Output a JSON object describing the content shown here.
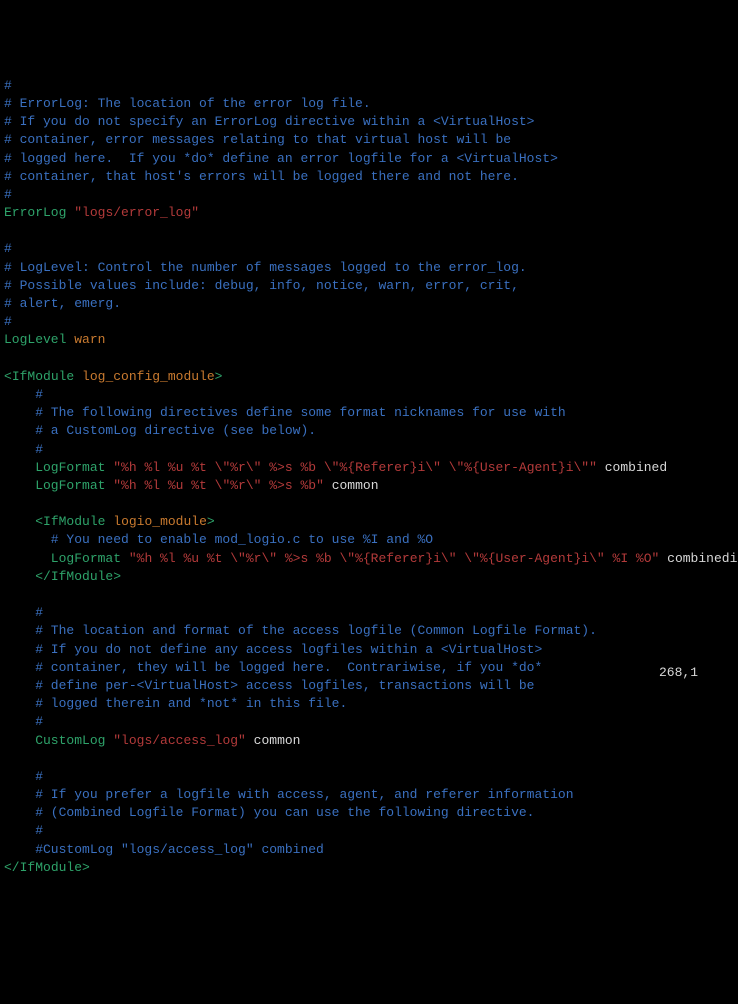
{
  "lines": {
    "c1": "#",
    "c2": "# ErrorLog: The location of the error log file.",
    "c3": "# If you do not specify an ErrorLog directive within a <VirtualHost>",
    "c4": "# container, error messages relating to that virtual host will be",
    "c5": "# logged here.  If you *do* define an error logfile for a <VirtualHost>",
    "c6": "# container, that host's errors will be logged there and not here.",
    "c7": "#",
    "errorlog_key": "ErrorLog",
    "errorlog_val": "\"logs/error_log\"",
    "blank1": "",
    "c8": "#",
    "c9": "# LogLevel: Control the number of messages logged to the error_log.",
    "c10": "# Possible values include: debug, info, notice, warn, error, crit,",
    "c11": "# alert, emerg.",
    "c12": "#",
    "loglevel_key": "LogLevel",
    "loglevel_val": "warn",
    "blank2": "",
    "ifmod_open_lt": "<",
    "ifmod_open_tag": "IfModule",
    "ifmod_open_arg": "log_config_module",
    "ifmod_open_gt": ">",
    "c13": "    #",
    "c14": "    # The following directives define some format nicknames for use with",
    "c15": "    # a CustomLog directive (see below).",
    "c16": "    #",
    "lf1_key": "    LogFormat",
    "lf1_val": "\"%h %l %u %t \\\"%r\\\" %>s %b \\\"%{Referer}i\\\" \\\"%{User-Agent}i\\\"\"",
    "lf1_name": "combined",
    "lf2_key": "    LogFormat",
    "lf2_val": "\"%h %l %u %t \\\"%r\\\" %>s %b\"",
    "lf2_name": "common",
    "blank3": "",
    "ifmod2_indent": "    ",
    "ifmod2_open_lt": "<",
    "ifmod2_open_tag": "IfModule",
    "ifmod2_open_arg": "logio_module",
    "ifmod2_open_gt": ">",
    "c17": "      # You need to enable mod_logio.c to use %I and %O",
    "lf3_key": "      LogFormat",
    "lf3_val": "\"%h %l %u %t \\\"%r\\\" %>s %b \\\"%{Referer}i\\\" \\\"%{User-Agent}i\\\" %I %O\"",
    "lf3_name": "combinedio",
    "ifmod2_close_indent": "    ",
    "ifmod2_close_lt": "</",
    "ifmod2_close_tag": "IfModule",
    "ifmod2_close_gt": ">",
    "blank4": "",
    "c18": "    #",
    "c19": "    # The location and format of the access logfile (Common Logfile Format).",
    "c20": "    # If you do not define any access logfiles within a <VirtualHost>",
    "c21": "    # container, they will be logged here.  Contrariwise, if you *do*",
    "c22": "    # define per-<VirtualHost> access logfiles, transactions will be",
    "c23": "    # logged therein and *not* in this file.",
    "c24": "    #",
    "customlog_key": "    CustomLog",
    "customlog_val": "\"logs/access_log\"",
    "customlog_name": "common",
    "blank5": "",
    "c25": "    #",
    "c26": "    # If you prefer a logfile with access, agent, and referer information",
    "c27": "    # (Combined Logfile Format) you can use the following directive.",
    "c28": "    #",
    "c29": "    #CustomLog \"logs/access_log\" combined",
    "ifmod_close_lt": "</",
    "ifmod_close_tag": "IfModule",
    "ifmod_close_gt": ">"
  },
  "status": "268,1"
}
